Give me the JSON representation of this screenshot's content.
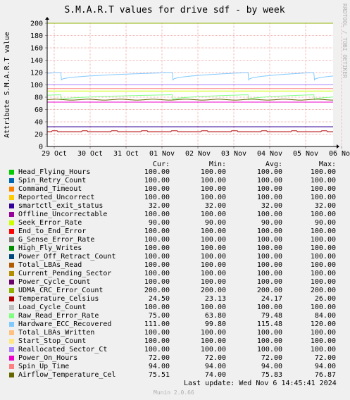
{
  "chart_data": {
    "type": "line",
    "title": "S.M.A.R.T values for drive sdf - by week",
    "ylabel": "Attribute S.M.A.R.T value",
    "side_label": "RRDTOOL / TOBI OETIKER",
    "ylim": [
      0,
      200
    ],
    "yticks": [
      "0",
      "20",
      "40",
      "60",
      "80",
      "100",
      "120",
      "140",
      "160",
      "180",
      "200"
    ],
    "xticks": [
      "29 Oct",
      "30 Oct",
      "31 Oct",
      "01 Nov",
      "02 Nov",
      "03 Nov",
      "04 Nov",
      "05 Nov",
      "06 Nov"
    ],
    "headers": {
      "cur": "Cur:",
      "min": "Min:",
      "avg": "Avg:",
      "max": "Max:"
    },
    "series": [
      {
        "name": "Head_Flying_Hours",
        "color": "#00cc00",
        "cur": "100.00",
        "min": "100.00",
        "avg": "100.00",
        "max": "100.00"
      },
      {
        "name": "Spin_Retry_Count",
        "color": "#0066b3",
        "cur": "100.00",
        "min": "100.00",
        "avg": "100.00",
        "max": "100.00"
      },
      {
        "name": "Command_Timeout",
        "color": "#ff8000",
        "cur": "100.00",
        "min": "100.00",
        "avg": "100.00",
        "max": "100.00"
      },
      {
        "name": "Reported_Uncorrect",
        "color": "#ffcc00",
        "cur": "100.00",
        "min": "100.00",
        "avg": "100.00",
        "max": "100.00"
      },
      {
        "name": "smartctl_exit_status",
        "color": "#330099",
        "cur": "32.00",
        "min": "32.00",
        "avg": "32.00",
        "max": "32.00"
      },
      {
        "name": "Offline_Uncorrectable",
        "color": "#990099",
        "cur": "100.00",
        "min": "100.00",
        "avg": "100.00",
        "max": "100.00"
      },
      {
        "name": "Seek_Error_Rate",
        "color": "#ccff00",
        "cur": "90.00",
        "min": "90.00",
        "avg": "90.00",
        "max": "90.00"
      },
      {
        "name": "End_to_End_Error",
        "color": "#ff0000",
        "cur": "100.00",
        "min": "100.00",
        "avg": "100.00",
        "max": "100.00"
      },
      {
        "name": "G_Sense_Error_Rate",
        "color": "#808080",
        "cur": "100.00",
        "min": "100.00",
        "avg": "100.00",
        "max": "100.00"
      },
      {
        "name": "High_Fly_Writes",
        "color": "#008f00",
        "cur": "100.00",
        "min": "100.00",
        "avg": "100.00",
        "max": "100.00"
      },
      {
        "name": "Power_Off_Retract_Count",
        "color": "#00487d",
        "cur": "100.00",
        "min": "100.00",
        "avg": "100.00",
        "max": "100.00"
      },
      {
        "name": "Total_LBAs_Read",
        "color": "#b35a00",
        "cur": "100.00",
        "min": "100.00",
        "avg": "100.00",
        "max": "100.00"
      },
      {
        "name": "Current_Pending_Sector",
        "color": "#b38f00",
        "cur": "100.00",
        "min": "100.00",
        "avg": "100.00",
        "max": "100.00"
      },
      {
        "name": "Power_Cycle_Count",
        "color": "#6b006b",
        "cur": "100.00",
        "min": "100.00",
        "avg": "100.00",
        "max": "100.00"
      },
      {
        "name": "UDMA_CRC_Error_Count",
        "color": "#8fb300",
        "cur": "200.00",
        "min": "200.00",
        "avg": "200.00",
        "max": "200.00"
      },
      {
        "name": "Temperature_Celsius",
        "color": "#b30000",
        "cur": "24.50",
        "min": "23.13",
        "avg": "24.17",
        "max": "26.00"
      },
      {
        "name": "Load_Cycle_Count",
        "color": "#bebebe",
        "cur": "100.00",
        "min": "100.00",
        "avg": "100.00",
        "max": "100.00"
      },
      {
        "name": "Raw_Read_Error_Rate",
        "color": "#80ff80",
        "cur": "75.00",
        "min": "63.80",
        "avg": "79.48",
        "max": "84.00"
      },
      {
        "name": "Hardware_ECC_Recovered",
        "color": "#80c9ff",
        "cur": "111.00",
        "min": "99.80",
        "avg": "115.48",
        "max": "120.00"
      },
      {
        "name": "Total_LBAs_Written",
        "color": "#ffc080",
        "cur": "100.00",
        "min": "100.00",
        "avg": "100.00",
        "max": "100.00"
      },
      {
        "name": "Start_Stop_Count",
        "color": "#ffe680",
        "cur": "100.00",
        "min": "100.00",
        "avg": "100.00",
        "max": "100.00"
      },
      {
        "name": "Reallocated_Sector_Ct",
        "color": "#aa80ff",
        "cur": "100.00",
        "min": "100.00",
        "avg": "100.00",
        "max": "100.00"
      },
      {
        "name": "Power_On_Hours",
        "color": "#ee00cc",
        "cur": "72.00",
        "min": "72.00",
        "avg": "72.00",
        "max": "72.00"
      },
      {
        "name": "Spin_Up_Time",
        "color": "#ff8080",
        "cur": "94.00",
        "min": "94.00",
        "avg": "94.00",
        "max": "94.00"
      },
      {
        "name": "Airflow_Temperature_Cel",
        "color": "#666600",
        "cur": "75.51",
        "min": "74.00",
        "avg": "75.83",
        "max": "76.87"
      }
    ],
    "grid": true
  },
  "footer": {
    "last_update": "Last update: Wed Nov  6 14:45:41 2024",
    "munin_version": "Munin 2.0.66"
  }
}
